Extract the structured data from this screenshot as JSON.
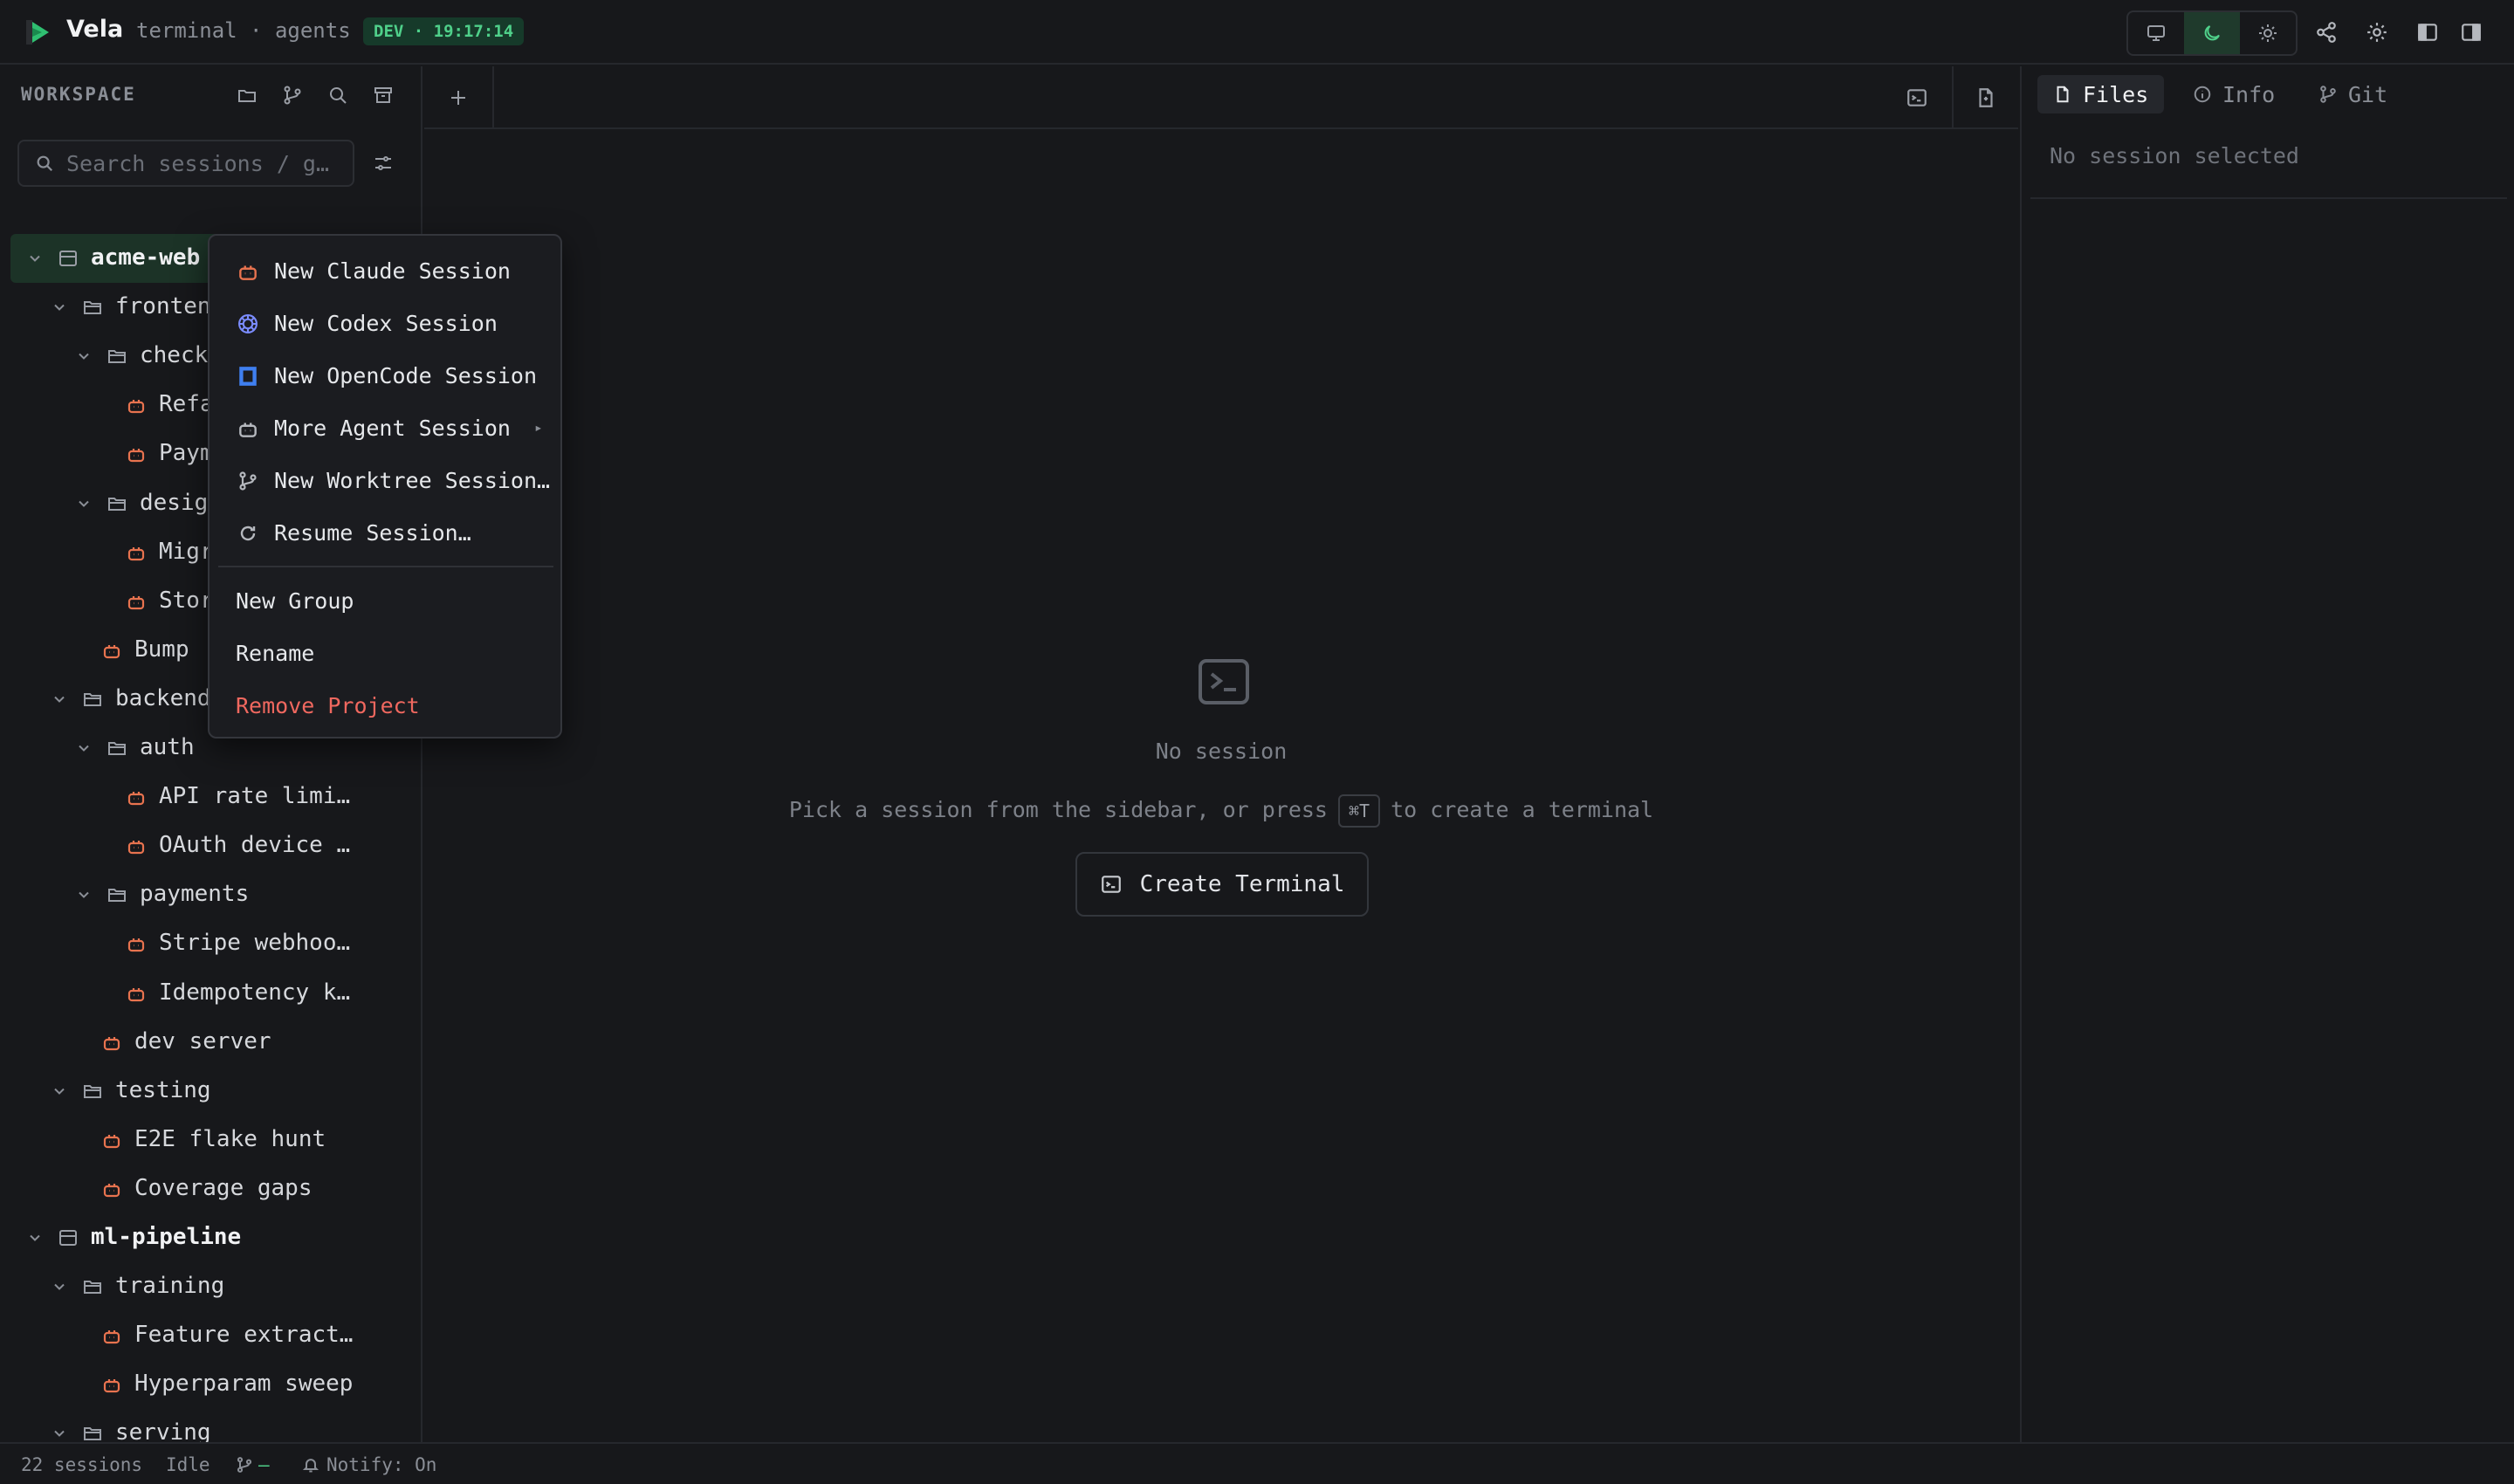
{
  "header": {
    "app_name": "Vela",
    "subtitle": "terminal · agents",
    "env_badge": "DEV · 19:17:14"
  },
  "sidebar": {
    "section_label": "WORKSPACE",
    "search_placeholder": "Search sessions / g…",
    "tree": [
      {
        "label": "acme-web",
        "kind": "project",
        "level": 0,
        "selected": true
      },
      {
        "label": "fronten",
        "kind": "folder",
        "level": 1
      },
      {
        "label": "checko",
        "kind": "folder",
        "level": 2
      },
      {
        "label": "Refa",
        "kind": "session",
        "level": 3
      },
      {
        "label": "Paym",
        "kind": "session",
        "level": 3
      },
      {
        "label": "design",
        "kind": "folder",
        "level": 2
      },
      {
        "label": "Migr",
        "kind": "session",
        "level": 3
      },
      {
        "label": "Stor",
        "kind": "session",
        "level": 3
      },
      {
        "label": "Bump ",
        "kind": "session",
        "level": 2
      },
      {
        "label": "backend",
        "kind": "folder",
        "level": 1
      },
      {
        "label": "auth",
        "kind": "folder",
        "level": 2
      },
      {
        "label": "API rate limi…",
        "kind": "session",
        "level": 3
      },
      {
        "label": "OAuth device …",
        "kind": "session",
        "level": 3
      },
      {
        "label": "payments",
        "kind": "folder",
        "level": 2
      },
      {
        "label": "Stripe webhoo…",
        "kind": "session",
        "level": 3
      },
      {
        "label": "Idempotency k…",
        "kind": "session",
        "level": 3
      },
      {
        "label": "dev server",
        "kind": "session",
        "level": 2
      },
      {
        "label": "testing",
        "kind": "folder",
        "level": 1
      },
      {
        "label": "E2E flake hunt",
        "kind": "session",
        "level": 2
      },
      {
        "label": "Coverage gaps",
        "kind": "session",
        "level": 2
      },
      {
        "label": "ml-pipeline",
        "kind": "project",
        "level": 0
      },
      {
        "label": "training",
        "kind": "folder",
        "level": 1
      },
      {
        "label": "Feature extract…",
        "kind": "session",
        "level": 2
      },
      {
        "label": "Hyperparam sweep",
        "kind": "session",
        "level": 2
      },
      {
        "label": "serving",
        "kind": "folder",
        "level": 1
      }
    ]
  },
  "context_menu": {
    "items": [
      {
        "label": "New Claude Session",
        "icon": "claude-icon"
      },
      {
        "label": "New Codex Session",
        "icon": "codex-icon"
      },
      {
        "label": "New OpenCode Session",
        "icon": "opencode-icon"
      },
      {
        "label": "More Agent Session",
        "icon": "robot-icon",
        "submenu": true
      },
      {
        "label": "New Worktree Session…",
        "icon": "git-branch-icon"
      },
      {
        "label": "Resume Session…",
        "icon": "refresh-icon"
      }
    ],
    "secondary": [
      {
        "label": "New Group"
      },
      {
        "label": "Rename"
      },
      {
        "label": "Remove Project",
        "danger": true
      }
    ]
  },
  "main": {
    "empty_title": "No session",
    "hint_before": "Pick a session from the sidebar, or press",
    "hint_kbd": "⌘T",
    "hint_after": "to create a terminal",
    "create_button": "Create Terminal"
  },
  "right_panel": {
    "tabs": [
      "Files",
      "Info",
      "Git"
    ],
    "active_tab": "Files",
    "empty": "No session selected"
  },
  "status": {
    "sessions": "22 sessions",
    "state": "Idle",
    "branch": "—",
    "notify": "Notify: On"
  },
  "colors": {
    "accent": "#4fd08a",
    "session_icon": "#e8734f",
    "danger": "#f0685f",
    "codex": "#7b8cff",
    "opencode": "#3f7ff0"
  }
}
